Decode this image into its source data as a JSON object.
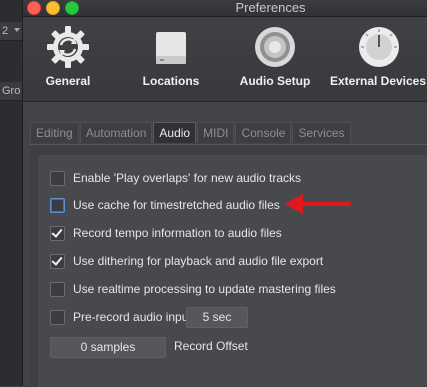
{
  "background_app": {
    "cells": [
      "2",
      "Gro"
    ]
  },
  "window": {
    "title": "Preferences"
  },
  "toolbar": {
    "items": [
      {
        "label": "General",
        "icon": "gear-icon"
      },
      {
        "label": "Locations",
        "icon": "drive-icon"
      },
      {
        "label": "Audio Setup",
        "icon": "speaker-icon"
      },
      {
        "label": "External Devices",
        "icon": "knob-icon"
      }
    ]
  },
  "tabs": [
    {
      "label": "Editing",
      "active": false
    },
    {
      "label": "Automation",
      "active": false
    },
    {
      "label": "Audio",
      "active": true
    },
    {
      "label": "MIDI",
      "active": false
    },
    {
      "label": "Console",
      "active": false
    },
    {
      "label": "Services",
      "active": false
    }
  ],
  "audio": {
    "options": [
      {
        "label": "Enable 'Play overlaps' for new audio tracks",
        "checked": false
      },
      {
        "label": "Use cache for timestretched audio files",
        "checked": false
      },
      {
        "label": "Record tempo information to audio files",
        "checked": true
      },
      {
        "label": "Use dithering for playback and audio file export",
        "checked": true
      },
      {
        "label": "Use realtime processing to update mastering files",
        "checked": false
      }
    ],
    "prerecord": {
      "label": "Pre-record audio input",
      "checked": false,
      "value": "5 sec"
    },
    "record_offset": {
      "value": "0 samples",
      "label": "Record Offset"
    }
  },
  "colors": {
    "arrow": "#e3161b",
    "focus": "#5b8fd8"
  }
}
